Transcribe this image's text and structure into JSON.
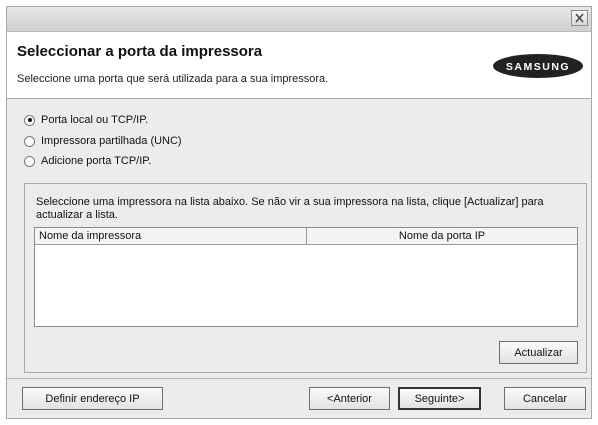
{
  "window": {
    "close_symbol": "✕"
  },
  "header": {
    "title": "Seleccionar a porta da impressora",
    "subtitle": "Seleccione uma porta que será utilizada para a sua impressora.",
    "logo_text": "SAMSUNG"
  },
  "options": [
    {
      "label": "Porta local ou TCP/IP.",
      "checked": true
    },
    {
      "label": "Impressora partilhada (UNC)",
      "checked": false
    },
    {
      "label": "Adicione porta TCP/IP.",
      "checked": false
    }
  ],
  "group": {
    "instruction": "Seleccione uma impressora na lista abaixo. Se não vir a sua impressora na lista, clique [Actualizar] para actualizar a lista.",
    "columns": [
      "Nome da impressora",
      "Nome da porta IP"
    ],
    "refresh_label": "Actualizar"
  },
  "footer": {
    "set_ip_label": "Definir endereço IP",
    "back_label": "<Anterior",
    "next_label": "Seguinte>",
    "cancel_label": "Cancelar"
  }
}
